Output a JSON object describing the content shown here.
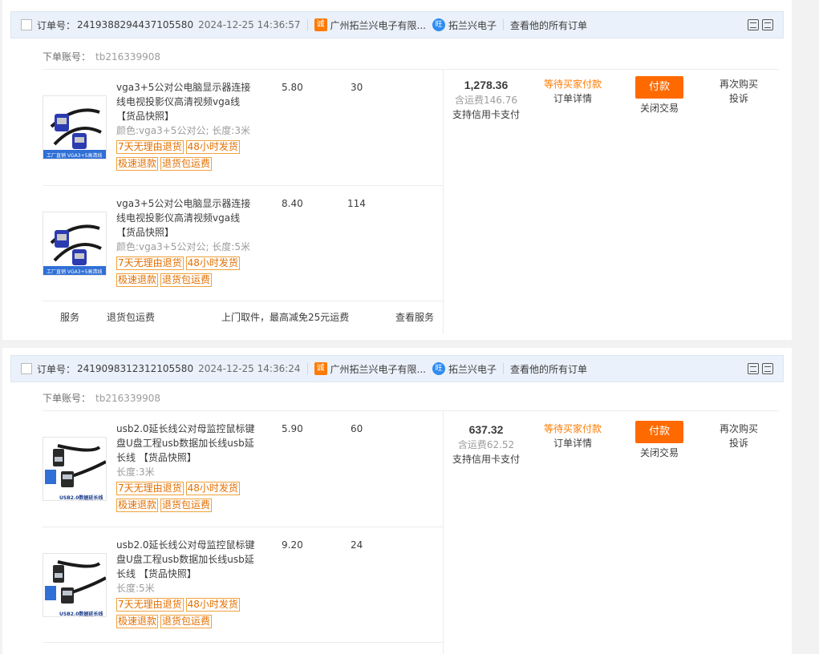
{
  "labels": {
    "order_no": "订单号：",
    "account": "下单账号：",
    "all_orders": "查看他的所有订单",
    "snapshot": "【货品快照】",
    "shop_icon": "诚",
    "ww_icon": "旺"
  },
  "colors": {
    "accent": "#ff6a00",
    "status": "#ff7a00",
    "header_bg": "#eaf1fb",
    "tag_border": "#f0a23c"
  },
  "orders": [
    {
      "order_id": "2419388294437105580",
      "time": "2024-12-25 14:36:57",
      "shop": "广州拓兰兴电子有限...",
      "seller": "拓兰兴电子",
      "account": "tb216339908",
      "total": "1,278.36",
      "shipping": "含运费146.76",
      "credit": "支持信用卡支付",
      "status": "等待买家付款",
      "detail": "订单详情",
      "pay_label": "付款",
      "close_label": "关闭交易",
      "rebuy": "再次购买",
      "complain": "投诉",
      "items": [
        {
          "title": "vga3+5公对公电脑显示器连接线电视投影仪高清视频vga线",
          "sku": "颜色:vga3+5公对公;  长度:3米",
          "price": "5.80",
          "qty": "30",
          "tags": [
            "7天无理由退货",
            "48小时发货",
            "极速退款",
            "退货包运费"
          ],
          "img_text": "工厂直销  VGA3+5高清线"
        },
        {
          "title": "vga3+5公对公电脑显示器连接线电视投影仪高清视频vga线",
          "sku": "颜色:vga3+5公对公;  长度:5米",
          "price": "8.40",
          "qty": "114",
          "tags": [
            "7天无理由退货",
            "48小时发货",
            "极速退款",
            "退货包运费"
          ],
          "img_text": "工厂直销  VGA3+5高清线"
        }
      ],
      "service": {
        "label": "服务",
        "name": "退货包运费",
        "desc": "上门取件，最高减免25元运费",
        "link": "查看服务"
      }
    },
    {
      "order_id": "2419098312312105580",
      "time": "2024-12-25 14:36:24",
      "shop": "广州拓兰兴电子有限...",
      "seller": "拓兰兴电子",
      "account": "tb216339908",
      "total": "637.32",
      "shipping": "含运费62.52",
      "credit": "支持信用卡支付",
      "status": "等待买家付款",
      "detail": "订单详情",
      "pay_label": "付款",
      "close_label": "关闭交易",
      "rebuy": "再次购买",
      "complain": "投诉",
      "items": [
        {
          "title": "usb2.0延长线公对母监控鼠标键盘U盘工程usb数据加长线usb延长线",
          "sku": "长度:3米",
          "price": "5.90",
          "qty": "60",
          "tags": [
            "7天无理由退货",
            "48小时发货",
            "极速退款",
            "退货包运费"
          ],
          "img_text": "USB2.0数据延长线"
        },
        {
          "title": "usb2.0延长线公对母监控鼠标键盘U盘工程usb数据加长线usb延长线",
          "sku": "长度:5米",
          "price": "9.20",
          "qty": "24",
          "tags": [
            "7天无理由退货",
            "48小时发货",
            "极速退款",
            "退货包运费"
          ],
          "img_text": "USB2.0数据延长线"
        }
      ]
    }
  ]
}
